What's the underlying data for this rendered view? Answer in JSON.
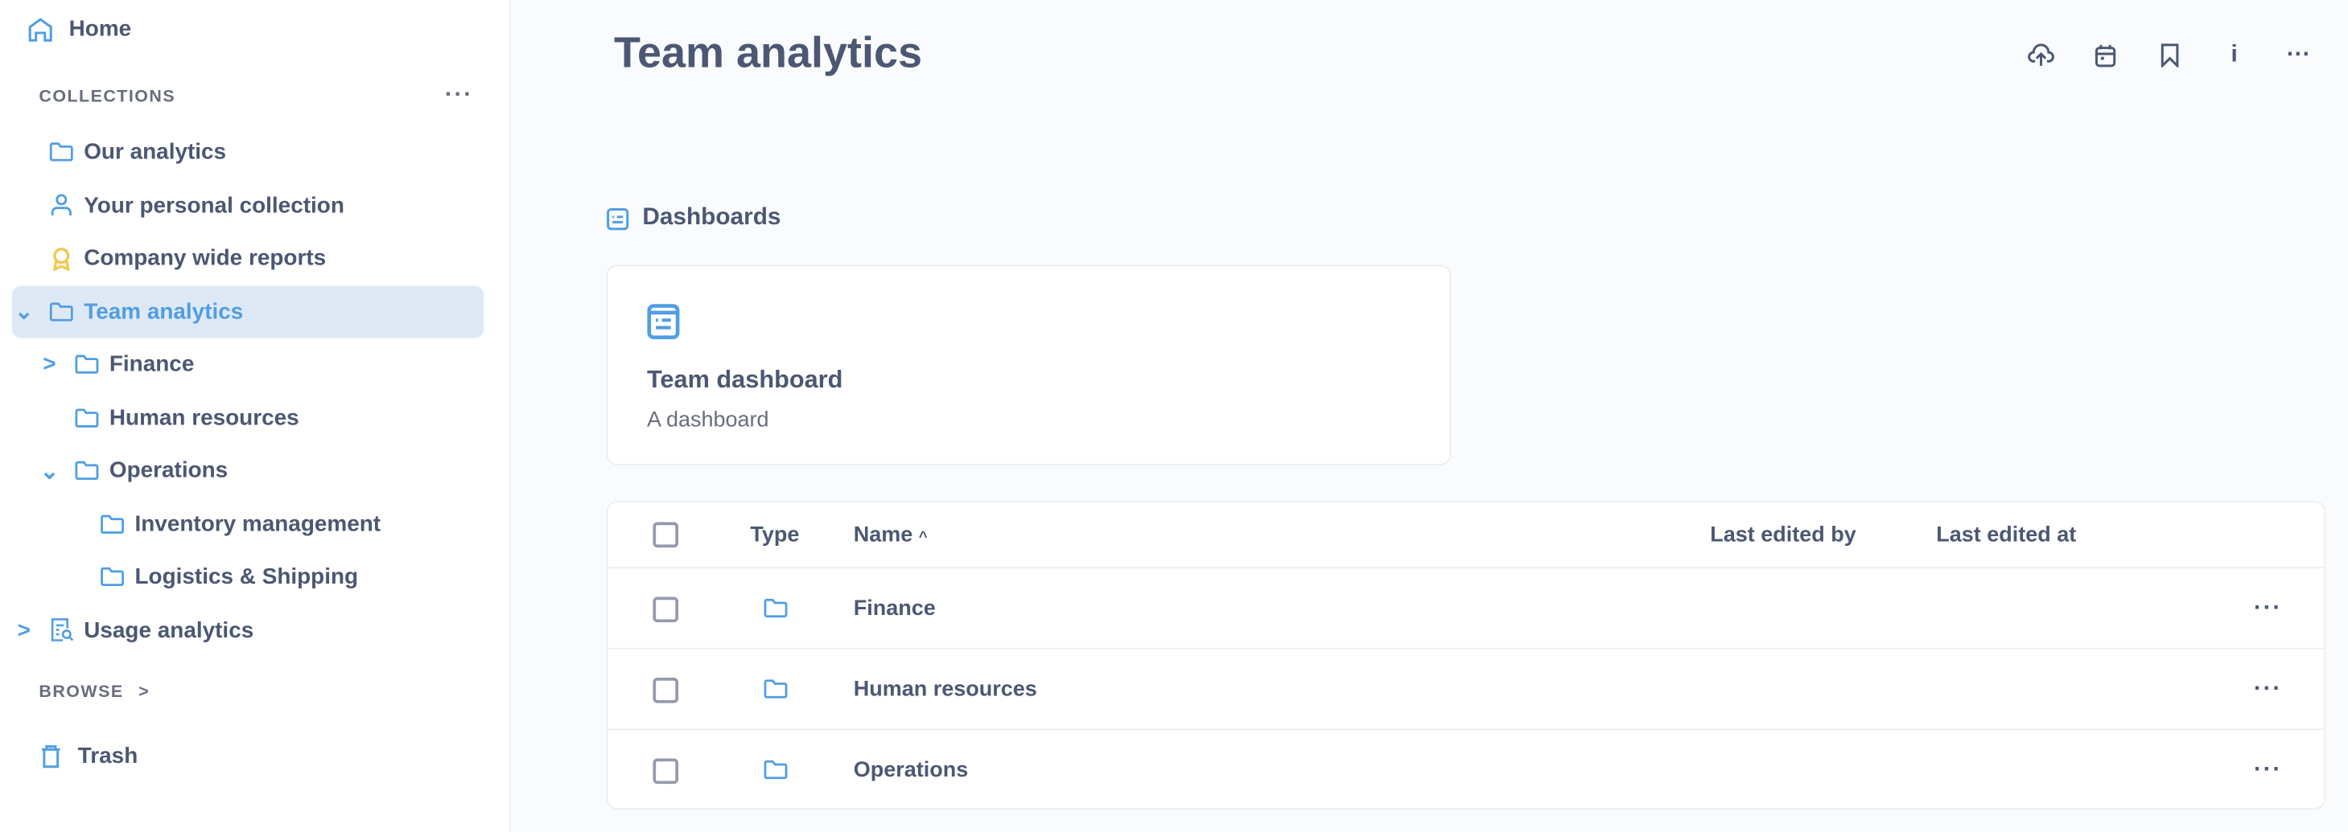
{
  "sidebar": {
    "home": "Home",
    "collections_label": "COLLECTIONS",
    "items": [
      {
        "label": "Our analytics",
        "icon": "folder-icon"
      },
      {
        "label": "Your personal collection",
        "icon": "person-icon"
      },
      {
        "label": "Company wide reports",
        "icon": "badge-icon"
      },
      {
        "label": "Team analytics",
        "icon": "folder-icon",
        "active": true,
        "expanded": true
      },
      {
        "label": "Finance",
        "icon": "folder-icon"
      },
      {
        "label": "Human resources",
        "icon": "folder-icon"
      },
      {
        "label": "Operations",
        "icon": "folder-icon",
        "expanded": true
      },
      {
        "label": "Inventory management",
        "icon": "folder-icon"
      },
      {
        "label": "Logistics & Shipping",
        "icon": "folder-icon"
      },
      {
        "label": "Usage analytics",
        "icon": "usage-analytics-icon"
      }
    ],
    "browse_label": "BROWSE",
    "trash": "Trash"
  },
  "header": {
    "title": "Team analytics",
    "actions": [
      "upload-icon",
      "calendar-icon",
      "bookmark-icon",
      "info-icon",
      "more-icon"
    ]
  },
  "dashboards": {
    "heading": "Dashboards",
    "card": {
      "title": "Team dashboard",
      "description": "A dashboard"
    }
  },
  "table": {
    "columns": {
      "type": "Type",
      "name": "Name",
      "edited_by": "Last edited by",
      "edited_at": "Last edited at"
    },
    "rows": [
      {
        "name": "Finance"
      },
      {
        "name": "Human resources"
      },
      {
        "name": "Operations"
      }
    ]
  },
  "colors": {
    "accent": "#509ee3",
    "text": "#4c5773",
    "active_bg": "#dfe9f5",
    "gold": "#f2c94c"
  }
}
